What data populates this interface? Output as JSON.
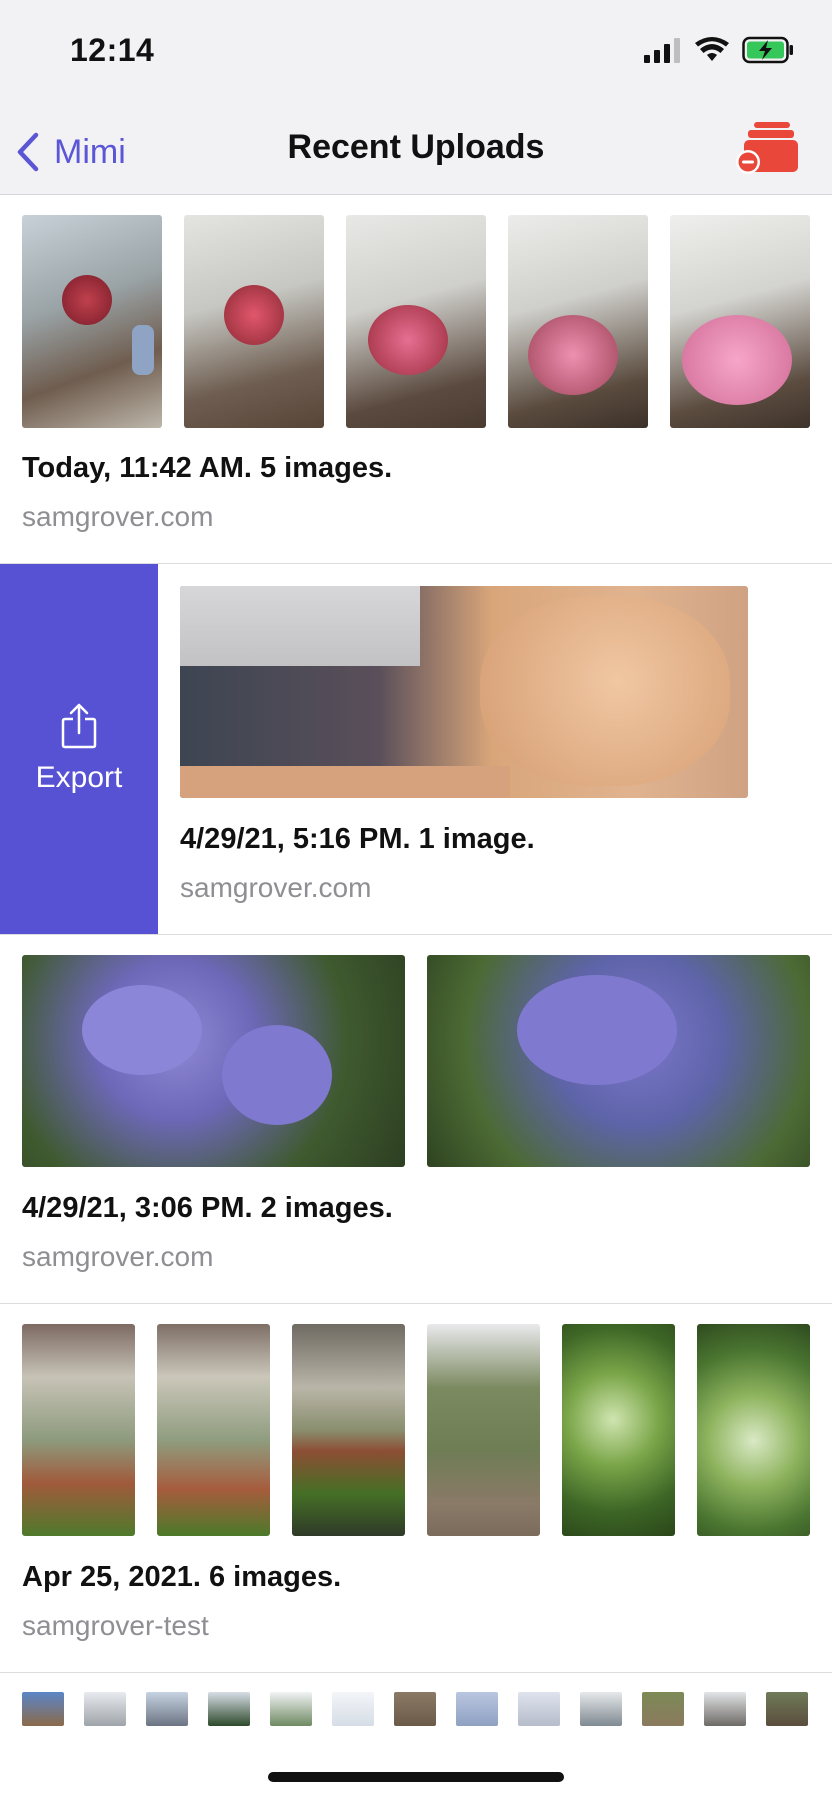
{
  "status_bar": {
    "time": "12:14"
  },
  "nav": {
    "back_label": "Mimi",
    "title": "Recent Uploads",
    "accent_color": "#5a56d6",
    "action_color": "#e8473a"
  },
  "uploads": [
    {
      "caption": "Today, 11:42 AM. 5 images.",
      "site": "samgrover.com",
      "image_count": 5
    },
    {
      "caption": "4/29/21, 5:16 PM. 1 image.",
      "site": "samgrover.com",
      "image_count": 1
    },
    {
      "caption": "4/29/21, 3:06 PM. 2 images.",
      "site": "samgrover.com",
      "image_count": 2
    },
    {
      "caption": "Apr 25, 2021. 6 images.",
      "site": "samgrover-test",
      "image_count": 6
    }
  ],
  "swipe_action": {
    "label": "Export",
    "color": "#5752d4"
  }
}
